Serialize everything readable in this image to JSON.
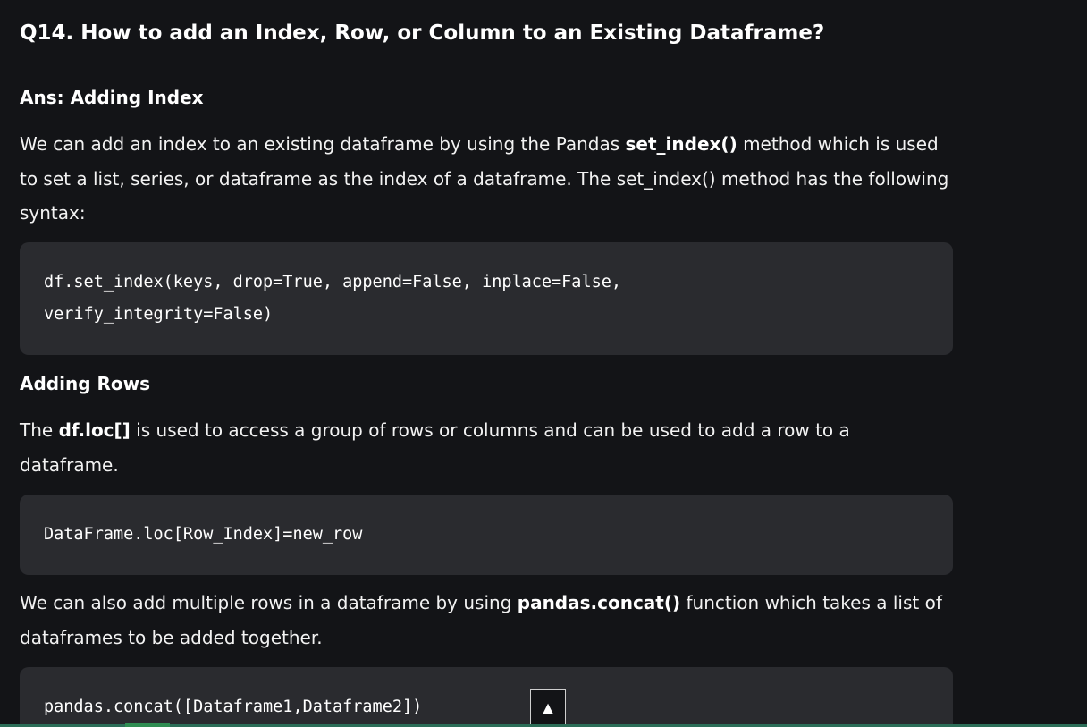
{
  "question": {
    "title": "Q14. How to add an Index, Row, or Column to an Existing Dataframe?"
  },
  "sections": {
    "adding_index": {
      "heading": "Ans: Adding Index",
      "para_before": "We can add an index to an existing dataframe by using the Pandas ",
      "para_bold": "set_index()",
      "para_after": " method which is used to set a list, series, or dataframe as the index of a dataframe. The set_index() method has the following syntax:",
      "code_line_1": "df.set_index(keys, drop=True, append=False, inplace=False,",
      "code_line_2": "verify_integrity=False)"
    },
    "adding_rows": {
      "heading": "Adding Rows",
      "para_before": "The ",
      "para_bold": "df.loc[]",
      "para_after": " is used to access a group of rows or columns and can be used to add a row to a dataframe.",
      "code_line_1": "DataFrame.loc[Row_Index]=new_row",
      "para2_before": "We can also add multiple rows in a dataframe by using ",
      "para2_bold": "pandas.concat()",
      "para2_after": " function which takes a list of dataframes to be added together.",
      "code2_line_1": "pandas.concat([Dataframe1,Dataframe2])"
    }
  },
  "controls": {
    "scroll_top_icon": "▲"
  },
  "colors": {
    "background": "#131417",
    "code_background": "#2a2b2f",
    "accent_bar": "#2c6e58"
  }
}
